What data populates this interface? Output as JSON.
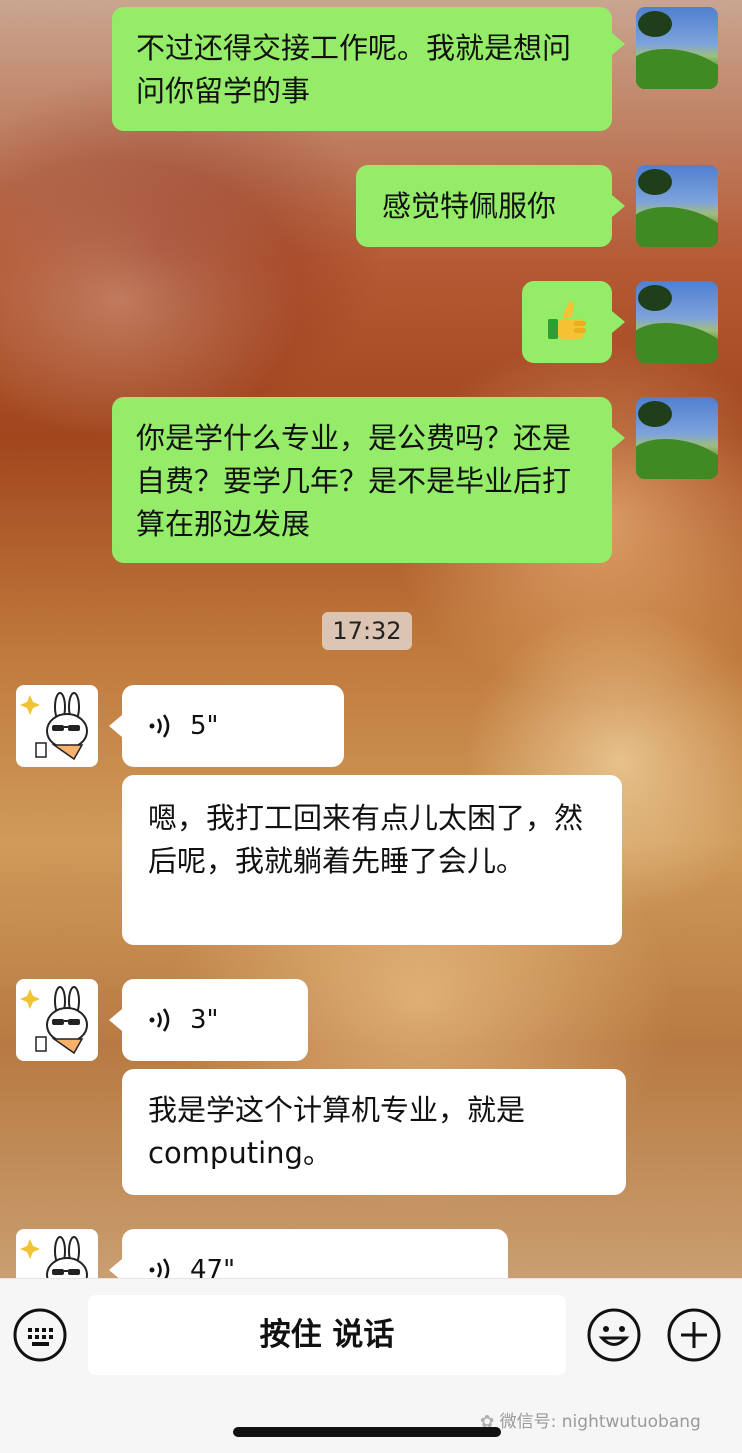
{
  "messages_out": [
    {
      "text": "不过还得交接工作呢。我就是想问问你留学的事"
    },
    {
      "text": "感觉特佩服你"
    },
    {
      "emoji": "👍"
    },
    {
      "text": "你是学什么专业，是公费吗？还是自费？要学几年？是不是毕业后打算在那边发展"
    }
  ],
  "timestamp": "17:32",
  "messages_in": [
    {
      "voice_duration": "5\"",
      "transcript": "嗯，我打工回来有点儿太困了，然后呢，我就躺着先睡了会儿。"
    },
    {
      "voice_duration": "3\"",
      "transcript": "我是学这个计算机专业，就是computing。"
    },
    {
      "voice_duration": "47\""
    }
  ],
  "input_bar": {
    "talk_button": "按住 说话",
    "keyboard_icon": "keyboard-icon",
    "emoji_icon": "emoji-icon",
    "plus_icon": "plus-icon"
  },
  "watermark": "微信号: nightwutuobang",
  "colors": {
    "out_bubble": "#95ec69",
    "in_bubble": "#ffffff"
  }
}
